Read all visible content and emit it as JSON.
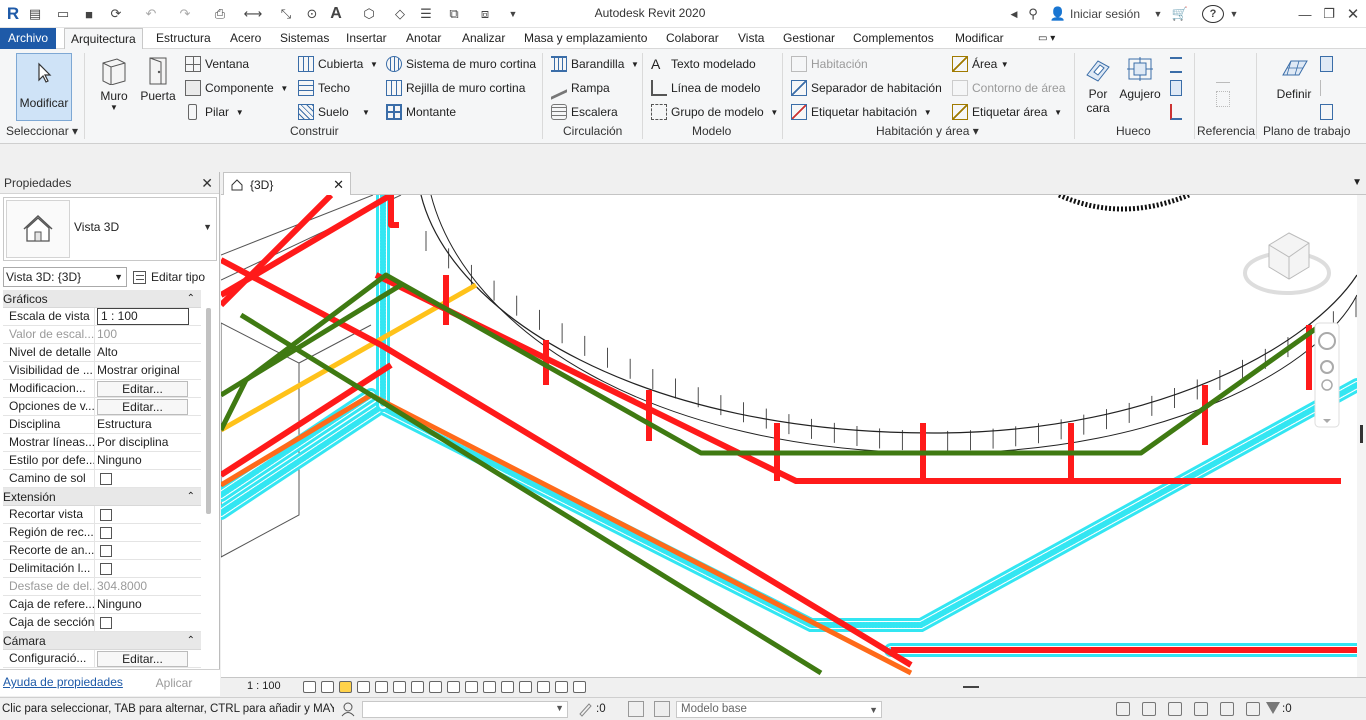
{
  "title_bar": {
    "app_title": "Autodesk Revit 2020",
    "sign_in": "Iniciar sesión",
    "help": "?"
  },
  "menu": {
    "file": "Archivo",
    "tabs": [
      "Arquitectura",
      "Estructura",
      "Acero",
      "Sistemas",
      "Insertar",
      "Anotar",
      "Analizar",
      "Masa y emplazamiento",
      "Colaborar",
      "Vista",
      "Gestionar",
      "Complementos",
      "Modificar"
    ]
  },
  "ribbon": {
    "modify": "Modificar",
    "select_panel": "Seleccionar",
    "wall": "Muro",
    "door": "Puerta",
    "window": "Ventana",
    "component": "Componente",
    "column": "Pilar",
    "roof": "Cubierta",
    "ceiling": "Techo",
    "floor": "Suelo",
    "curtain_system": "Sistema de muro cortina",
    "curtain_grid": "Rejilla de muro cortina",
    "mullion": "Montante",
    "build_panel": "Construir",
    "railing": "Barandilla",
    "ramp": "Rampa",
    "stair": "Escalera",
    "circulation_panel": "Circulación",
    "model_text": "Texto modelado",
    "model_line": "Línea de modelo",
    "model_group": "Grupo de modelo",
    "model_panel": "Modelo",
    "room": "Habitación",
    "room_separator": "Separador de habitación",
    "tag_room": "Etiquetar habitación",
    "area": "Área",
    "area_boundary": "Contorno de área",
    "tag_area": "Etiquetar área",
    "room_area_panel": "Habitación y área",
    "by_face_1": "Por",
    "by_face_2": "cara",
    "shaft": "Agujero",
    "opening_panel": "Hueco",
    "datum_panel": "Referencia",
    "set": "Definir",
    "workplane_panel": "Plano de trabajo"
  },
  "properties": {
    "title": "Propiedades",
    "type_name": "Vista 3D",
    "selector": "Vista 3D: {3D}",
    "edit_type": "Editar tipo",
    "groups": [
      {
        "name": "Gráficos",
        "rows": [
          {
            "key": "Escala de vista",
            "value": "1 : 100",
            "kind": "input"
          },
          {
            "key": "Valor de escal...",
            "value": "100",
            "kind": "disabled"
          },
          {
            "key": "Nivel de detalle",
            "value": "Alto",
            "kind": "text"
          },
          {
            "key": "Visibilidad de ...",
            "value": "Mostrar original",
            "kind": "text"
          },
          {
            "key": "Modificacion...",
            "value": "Editar...",
            "kind": "button"
          },
          {
            "key": "Opciones de v...",
            "value": "Editar...",
            "kind": "button"
          },
          {
            "key": "Disciplina",
            "value": "Estructura",
            "kind": "text"
          },
          {
            "key": "Mostrar líneas...",
            "value": "Por disciplina",
            "kind": "text"
          },
          {
            "key": "Estilo por defe...",
            "value": "Ninguno",
            "kind": "text"
          },
          {
            "key": "Camino de sol",
            "value": "",
            "kind": "check"
          }
        ]
      },
      {
        "name": "Extensión",
        "rows": [
          {
            "key": "Recortar vista",
            "value": "",
            "kind": "check"
          },
          {
            "key": "Región de rec...",
            "value": "",
            "kind": "check"
          },
          {
            "key": "Recorte de an...",
            "value": "",
            "kind": "check"
          },
          {
            "key": "Delimitación l...",
            "value": "",
            "kind": "check"
          },
          {
            "key": "Desfase de del...",
            "value": "304.8000",
            "kind": "disabled"
          },
          {
            "key": "Caja de refere...",
            "value": "Ninguno",
            "kind": "text"
          },
          {
            "key": "Caja de sección",
            "value": "",
            "kind": "check"
          }
        ]
      },
      {
        "name": "Cámara",
        "rows": [
          {
            "key": "Configuració...",
            "value": "Editar...",
            "kind": "button"
          }
        ]
      }
    ],
    "help_link": "Ayuda de propiedades",
    "apply": "Aplicar"
  },
  "view": {
    "tab": "{3D}",
    "scale": "1 : 100",
    "colors": {
      "hot": "#ff1a1a",
      "cold": "#33e6f2",
      "green": "#3f7a12",
      "orange": "#ff6a1a",
      "yellow": "#ffc21a"
    }
  },
  "status": {
    "message": "Clic para seleccionar, TAB para alternar, CTRL para añadir y MAYÚS para quitar",
    "count_1": ":0",
    "model": "Modelo base",
    "count_2": ":0"
  }
}
